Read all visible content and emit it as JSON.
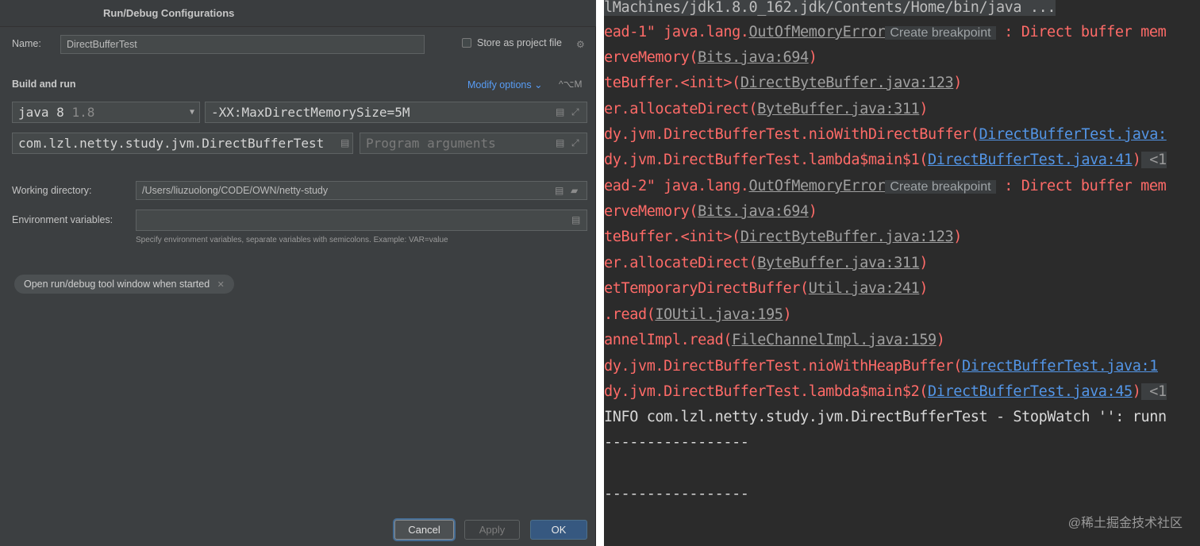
{
  "dialog": {
    "title": "Run/Debug Configurations",
    "name_label": "Name:",
    "name_value": "DirectBufferTest",
    "store_label": "Store as project file",
    "build_run_label": "Build and run",
    "modify_options": "Modify options",
    "modify_shortcut": "^⌥M",
    "jdk_name": "java 8",
    "jdk_version": "1.8",
    "vm_options": "-XX:MaxDirectMemorySize=5M",
    "main_class": "com.lzl.netty.study.jvm.DirectBufferTest",
    "program_args_placeholder": "Program arguments",
    "working_dir_label": "Working directory:",
    "working_dir_value": "/Users/liuzuolong/CODE/OWN/netty-study",
    "env_label": "Environment variables:",
    "env_hint": "Specify environment variables, separate variables with semicolons. Example: VAR=value",
    "chip_label": "Open run/debug tool window when started",
    "cancel": "Cancel",
    "apply": "Apply",
    "ok": "OK",
    "colors": {
      "background": "#3c3f41",
      "ok_button": "#365880",
      "link": "#589df6"
    }
  },
  "console": {
    "line0": "lMachines/jdk1.8.0_162.jdk/Contents/Home/bin/java ...",
    "l1a": "ead-1\" java.lang.",
    "l1b": "OutOfMemoryError",
    "l1c": "Create breakpoint",
    "l1d": " : Direct buffer mem",
    "l2a": "erveMemory(",
    "l2b": "Bits.java:694",
    "l2c": ")",
    "l3a": "teBuffer.<init>(",
    "l3b": "DirectByteBuffer.java:123",
    "l3c": ")",
    "l4a": "er.allocateDirect(",
    "l4b": "ByteBuffer.java:311",
    "l4c": ")",
    "l5a": "dy.jvm.DirectBufferTest.nioWithDirectBuffer(",
    "l5b": "DirectBufferTest.java:",
    "l6a": "dy.jvm.DirectBufferTest.lambda$main$1(",
    "l6b": "DirectBufferTest.java:41",
    "l6c": ")",
    "l6d": " <1",
    "l7a": "ead-2\" java.lang.",
    "l7b": "OutOfMemoryError",
    "l7c": "Create breakpoint",
    "l7d": " : Direct buffer mem",
    "l8a": "erveMemory(",
    "l8b": "Bits.java:694",
    "l8c": ")",
    "l9a": "teBuffer.<init>(",
    "l9b": "DirectByteBuffer.java:123",
    "l9c": ")",
    "l10a": "er.allocateDirect(",
    "l10b": "ByteBuffer.java:311",
    "l10c": ")",
    "l11a": "etTemporaryDirectBuffer(",
    "l11b": "Util.java:241",
    "l11c": ")",
    "l12a": ".read(",
    "l12b": "IOUtil.java:195",
    "l12c": ")",
    "l13a": "annelImpl.read(",
    "l13b": "FileChannelImpl.java:159",
    "l13c": ")",
    "l14a": "dy.jvm.DirectBufferTest.nioWithHeapBuffer(",
    "l14b": "DirectBufferTest.java:1",
    "l15a": "dy.jvm.DirectBufferTest.lambda$main$2(",
    "l15b": "DirectBufferTest.java:45",
    "l15c": ")",
    "l15d": " <1",
    "l16": "INFO com.lzl.netty.study.jvm.DirectBufferTest - StopWatch '': runn",
    "l17": "-----------------",
    "l18": "-----------------",
    "watermark": "@稀土掘金技术社区"
  }
}
